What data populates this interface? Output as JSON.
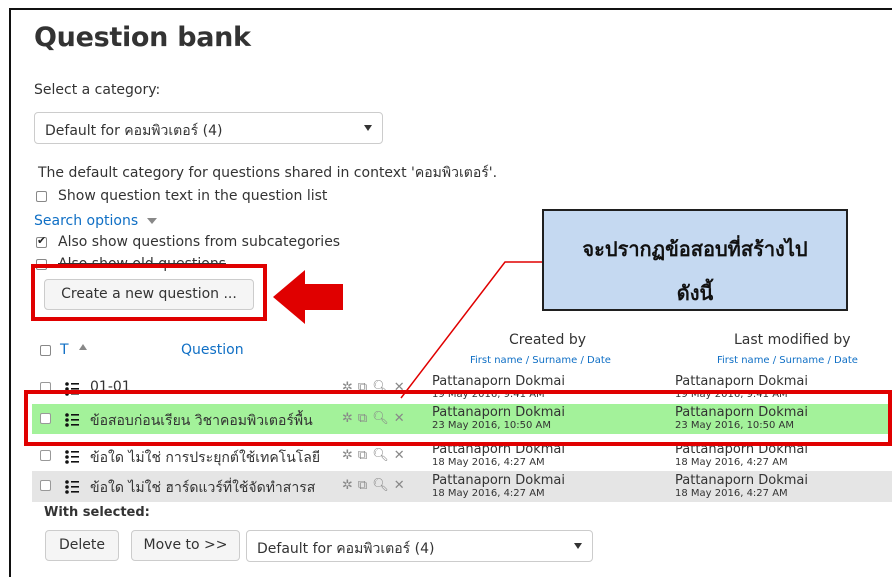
{
  "page": {
    "title": "Question bank"
  },
  "category": {
    "label": "Select a category:",
    "selected": "Default for คอมพิวเตอร์ (4)",
    "description": "The default category for questions shared in context 'คอมพิวเตอร์'."
  },
  "options": {
    "show_text": "Show question text in the question list",
    "search_options": "Search options",
    "subcategories": "Also show questions from subcategories",
    "old_questions": "Also show old questions"
  },
  "create_button": "Create a new question ...",
  "table": {
    "col_type": "T",
    "col_question": "Question",
    "created_by": "Created by",
    "last_modified_by": "Last modified by",
    "sub_header": "First name / Surname / Date",
    "rows": [
      {
        "name": "01-01",
        "created_by": "Pattanaporn Dokmai",
        "created_date": "19 May 2016, 9:41 AM",
        "modified_by": "Pattanaporn Dokmai",
        "modified_date": "19 May 2016, 9:41 AM"
      },
      {
        "name": "ข้อสอบก่อนเรียน วิชาคอมพิวเตอร์พื้น",
        "created_by": "Pattanaporn Dokmai",
        "created_date": "23 May 2016, 10:50 AM",
        "modified_by": "Pattanaporn Dokmai",
        "modified_date": "23 May 2016, 10:50 AM"
      },
      {
        "name": "ข้อใด ไม่ใช่ การประยุกต์ใช้เทคโนโลยี",
        "created_by": "Pattanaporn Dokmai",
        "created_date": "18 May 2016, 4:27 AM",
        "modified_by": "Pattanaporn Dokmai",
        "modified_date": "18 May 2016, 4:27 AM"
      },
      {
        "name": "ข้อใด ไม่ใช่ ฮาร์ดแวร์ที่ใช้จัดทำสารส",
        "created_by": "Pattanaporn Dokmai",
        "created_date": "18 May 2016, 4:27 AM",
        "modified_by": "Pattanaporn Dokmai",
        "modified_date": "18 May 2016, 4:27 AM"
      }
    ]
  },
  "with_selected": {
    "label": "With selected:",
    "delete": "Delete",
    "move_to": "Move to >>",
    "target": "Default for คอมพิวเตอร์ (4)"
  },
  "annotation": {
    "line1": "จะปรากฏข้อสอบที่สร้างไป",
    "line2": "ดังนี้"
  },
  "colors": {
    "highlight": "#e00000",
    "row_new": "#a3f29a",
    "row_alt": "#e5e5e5",
    "link": "#0f6fc5",
    "callout_bg": "#c5d9f1"
  }
}
